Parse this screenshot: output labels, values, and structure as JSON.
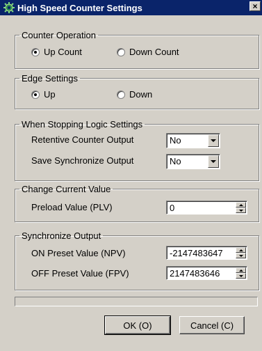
{
  "window": {
    "title": "High Speed Counter Settings",
    "close_label": "×"
  },
  "counter_operation": {
    "legend": "Counter Operation",
    "options": [
      {
        "label": "Up Count",
        "selected": true
      },
      {
        "label": "Down Count",
        "selected": false
      }
    ]
  },
  "edge_settings": {
    "legend": "Edge Settings",
    "options": [
      {
        "label": "Up",
        "selected": true
      },
      {
        "label": "Down",
        "selected": false
      }
    ]
  },
  "stopping_logic": {
    "legend": "When Stopping Logic Settings",
    "retentive_label": "Retentive Counter Output",
    "retentive_value": "No",
    "save_sync_label": "Save Synchronize Output",
    "save_sync_value": "No"
  },
  "change_current": {
    "legend": "Change Current Value",
    "preload_label": "Preload Value (PLV)",
    "preload_value": "0"
  },
  "sync_output": {
    "legend": "Synchronize Output",
    "on_label": "ON Preset Value (NPV)",
    "on_value": "-2147483647",
    "off_label": "OFF Preset Value (FPV)",
    "off_value": "2147483646"
  },
  "progress": {
    "value": 0
  },
  "buttons": {
    "ok": "OK (O)",
    "cancel": "Cancel (C)"
  },
  "colors": {
    "titlebar": "#0a246a",
    "face": "#d4d0c8"
  }
}
